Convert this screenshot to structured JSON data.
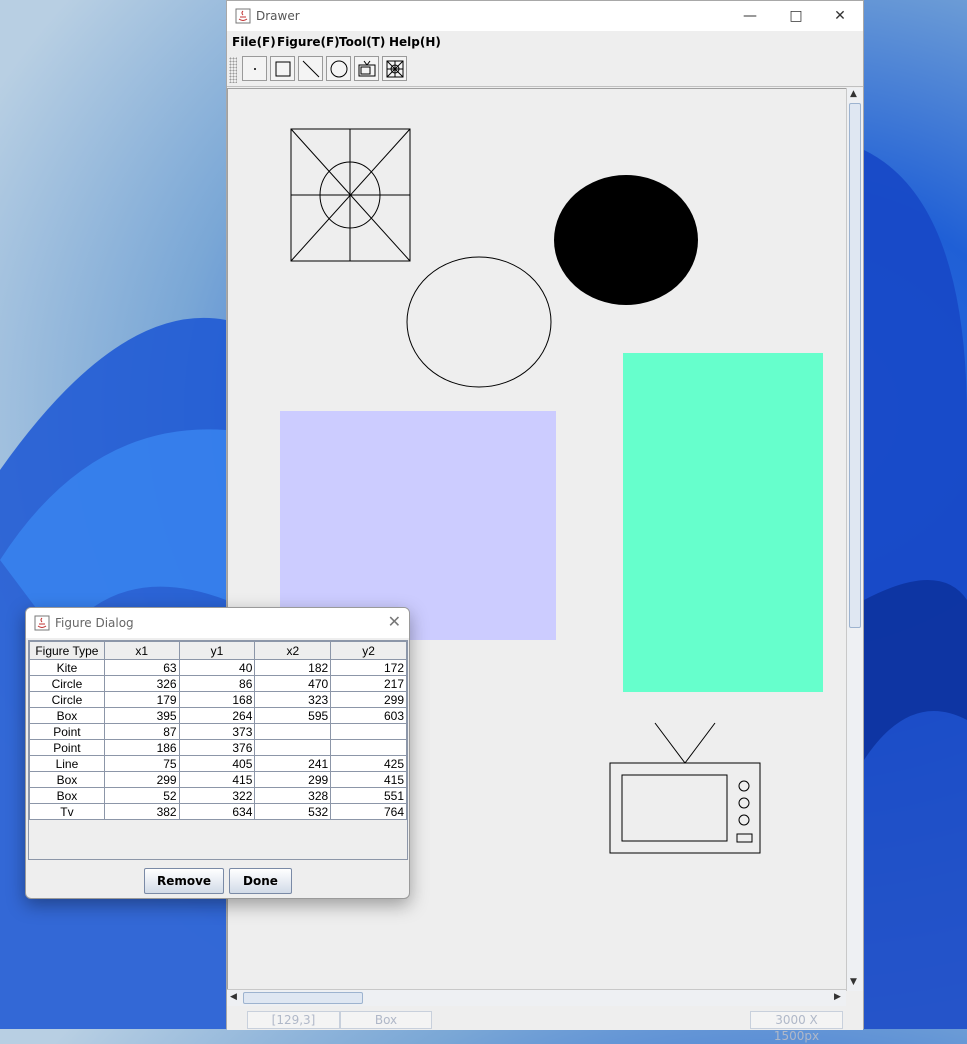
{
  "window": {
    "title": "Drawer",
    "menus": [
      "File(F)",
      "Figure(F)",
      "Tool(T)",
      "Help(H)"
    ],
    "tools": [
      "point-tool-icon",
      "box-tool-icon",
      "line-tool-icon",
      "circle-tool-icon",
      "tv-tool-icon",
      "kite-tool-icon"
    ],
    "status": {
      "coords": "[129,3]",
      "figure": "Box",
      "size": "3000 X 1500px"
    }
  },
  "dialog": {
    "title": "Figure Dialog",
    "columns": [
      "Figure Type",
      "x1",
      "y1",
      "x2",
      "y2"
    ],
    "rows": [
      [
        "Kite",
        "63",
        "40",
        "182",
        "172"
      ],
      [
        "Circle",
        "326",
        "86",
        "470",
        "217"
      ],
      [
        "Circle",
        "179",
        "168",
        "323",
        "299"
      ],
      [
        "Box",
        "395",
        "264",
        "595",
        "603"
      ],
      [
        "Point",
        "87",
        "373",
        "",
        ""
      ],
      [
        "Point",
        "186",
        "376",
        "",
        ""
      ],
      [
        "Line",
        "75",
        "405",
        "241",
        "425"
      ],
      [
        "Box",
        "299",
        "415",
        "299",
        "415"
      ],
      [
        "Box",
        "52",
        "322",
        "328",
        "551"
      ],
      [
        "Tv",
        "382",
        "634",
        "532",
        "764"
      ]
    ],
    "remove_label": "Remove",
    "done_label": "Done"
  },
  "colors": {
    "box_lavender": "#ccccff",
    "box_mint": "#66ffcc",
    "filled_circle": "#000000"
  }
}
